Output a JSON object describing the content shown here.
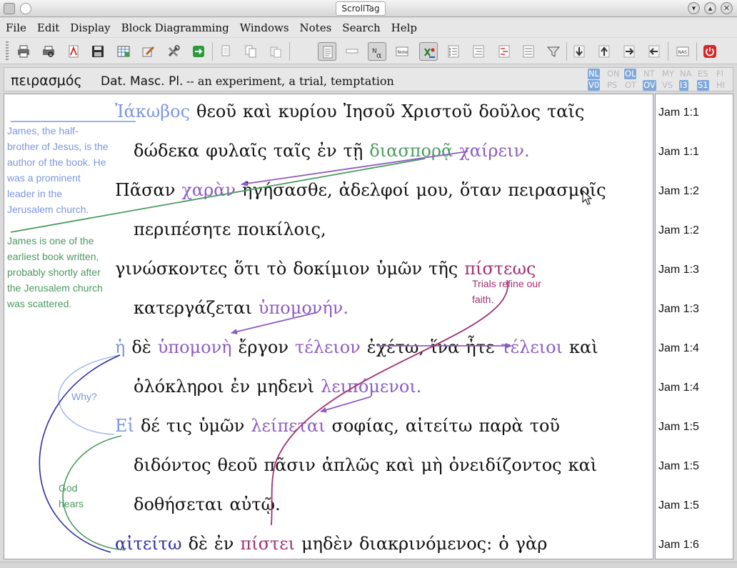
{
  "window": {
    "title": "ScrollTag"
  },
  "menu": [
    "File",
    "Edit",
    "Display",
    "Block Diagramming",
    "Windows",
    "Notes",
    "Search",
    "Help"
  ],
  "toolbar": {
    "tools": [
      "print-icon",
      "print-preview-icon",
      "pdf-icon",
      "save-icon",
      "table-icon",
      "edit-icon",
      "tools-icon",
      "export-icon",
      "copy-icon",
      "copy-alt-icon",
      "paste-icon",
      "page-icon",
      "line-icon",
      "greek-alpha-icon",
      "note-icon",
      "verse-check-icon",
      "numbered-list-icon",
      "align-icon",
      "outline-icon",
      "text-block-icon",
      "filter-icon",
      "down-arrow-icon",
      "up-arrow-icon",
      "next-icon",
      "prev-icon",
      "nas-icon",
      "power-icon"
    ],
    "note_label": "Note",
    "nas_label": "NAS"
  },
  "infobar": {
    "word": "πειρασμός",
    "parse": "Dat. Masc. Pl.",
    "definition": "-- an experiment, a trial, temptation"
  },
  "versions": {
    "row1": [
      {
        "label": "NL",
        "active": true
      },
      {
        "label": "ON",
        "active": false
      },
      {
        "label": "OL",
        "active": true
      },
      {
        "label": "NT",
        "active": false
      },
      {
        "label": "MY",
        "active": false
      },
      {
        "label": "NA",
        "active": false
      },
      {
        "label": "ES",
        "active": false
      },
      {
        "label": "FI",
        "active": false
      }
    ],
    "row2": [
      {
        "label": "V0",
        "active": true
      },
      {
        "label": "PS",
        "active": false
      },
      {
        "label": "OT",
        "active": false
      },
      {
        "label": "OV",
        "active": true
      },
      {
        "label": "VS",
        "active": false
      },
      {
        "label": "I3",
        "active": true
      },
      {
        "label": "S1",
        "active": true
      },
      {
        "label": "HI",
        "active": false
      }
    ]
  },
  "text_lines": [
    {
      "ref": "Jam 1:1",
      "indent": false,
      "words": [
        {
          "t": "Ἰάκωβος",
          "c": "w-lblue"
        },
        {
          "t": "θεοῦ"
        },
        {
          "t": "καὶ"
        },
        {
          "t": "κυρίου"
        },
        {
          "t": "Ἰησοῦ"
        },
        {
          "t": "Χριστοῦ"
        },
        {
          "t": "δοῦλος"
        },
        {
          "t": "ταῖς"
        }
      ]
    },
    {
      "ref": "Jam 1:1",
      "indent": true,
      "words": [
        {
          "t": "δώδεκα"
        },
        {
          "t": "φυλαῖς"
        },
        {
          "t": "ταῖς"
        },
        {
          "t": "ἐν"
        },
        {
          "t": "τῇ"
        },
        {
          "t": "διασπορᾷ",
          "c": "w-green"
        },
        {
          "t": "χαίρειν.",
          "c": "w-purple"
        }
      ]
    },
    {
      "ref": "Jam 1:2",
      "indent": false,
      "words": [
        {
          "t": "Πᾶσαν"
        },
        {
          "t": "χαρὰν",
          "c": "w-purple"
        },
        {
          "t": "ἡγήσασθε,"
        },
        {
          "t": "ἀδελφοί"
        },
        {
          "t": "μου,"
        },
        {
          "t": "ὅταν"
        },
        {
          "t": "πειρασμοῖς"
        }
      ]
    },
    {
      "ref": "Jam 1:2",
      "indent": true,
      "words": [
        {
          "t": "περιπέσητε"
        },
        {
          "t": "ποικίλοις,"
        }
      ]
    },
    {
      "ref": "Jam 1:3",
      "indent": false,
      "words": [
        {
          "t": "γινώσκοντες"
        },
        {
          "t": "ὅτι"
        },
        {
          "t": "τὸ"
        },
        {
          "t": "δοκίμιον"
        },
        {
          "t": "ὑμῶν"
        },
        {
          "t": "τῆς"
        },
        {
          "t": "πίστεως",
          "c": "w-maroon"
        }
      ]
    },
    {
      "ref": "Jam 1:3",
      "indent": true,
      "words": [
        {
          "t": "κατεργάζεται"
        },
        {
          "t": "ὑπομονήν.",
          "c": "w-purple"
        }
      ]
    },
    {
      "ref": "Jam 1:4",
      "indent": false,
      "words": [
        {
          "t": "ἡ",
          "c": "w-lblue"
        },
        {
          "t": "δὲ"
        },
        {
          "t": "ὑπομονὴ",
          "c": "w-purple"
        },
        {
          "t": "ἔργον"
        },
        {
          "t": "τέλειον",
          "c": "w-purple"
        },
        {
          "t": "ἐχέτω,"
        },
        {
          "t": "ἵνα"
        },
        {
          "t": "ἦτε"
        },
        {
          "t": "τέλειοι",
          "c": "w-purple"
        },
        {
          "t": "καὶ"
        }
      ]
    },
    {
      "ref": "Jam 1:4",
      "indent": true,
      "words": [
        {
          "t": "ὁλόκληροι"
        },
        {
          "t": "ἐν"
        },
        {
          "t": "μηδενὶ"
        },
        {
          "t": "λειπόμενοι.",
          "c": "w-purple"
        }
      ]
    },
    {
      "ref": "Jam 1:5",
      "indent": false,
      "words": [
        {
          "t": "Εἰ",
          "c": "w-lblue"
        },
        {
          "t": "δέ"
        },
        {
          "t": "τις"
        },
        {
          "t": "ὑμῶν"
        },
        {
          "t": "λείπεται",
          "c": "w-purple"
        },
        {
          "t": "σοφίας,"
        },
        {
          "t": "αἰτείτω"
        },
        {
          "t": "παρὰ"
        },
        {
          "t": "τοῦ"
        }
      ]
    },
    {
      "ref": "Jam 1:5",
      "indent": true,
      "words": [
        {
          "t": "διδόντος"
        },
        {
          "t": "θεοῦ"
        },
        {
          "t": "πᾶσιν"
        },
        {
          "t": "ἁπλῶς"
        },
        {
          "t": "καὶ"
        },
        {
          "t": "μὴ"
        },
        {
          "t": "ὀνειδίζοντος"
        },
        {
          "t": "καὶ"
        }
      ]
    },
    {
      "ref": "Jam 1:5",
      "indent": true,
      "words": [
        {
          "t": "δοθήσεται"
        },
        {
          "t": "αὐτῷ."
        }
      ]
    },
    {
      "ref": "Jam 1:6",
      "indent": false,
      "words": [
        {
          "t": "αἰτείτω",
          "c": "w-navy"
        },
        {
          "t": "δὲ"
        },
        {
          "t": "ἐν"
        },
        {
          "t": "πίστει",
          "c": "w-maroon"
        },
        {
          "t": "μηδὲν"
        },
        {
          "t": "διακρινόμενος:"
        },
        {
          "t": "ὁ"
        },
        {
          "t": "γὰρ"
        }
      ]
    }
  ],
  "notes": {
    "james_author": "James, the half-brother of Jesus, is the author of the book. He was a prominent leader in the Jerusalem church.",
    "earliest_book": "James is one of the earliest book written, probably shortly after the Jerusalem church was scattered.",
    "trials": "Trials refine our faith.",
    "why": "Why?",
    "god_hears": "God hears"
  },
  "colors": {
    "light_blue": "#7b97de",
    "green": "#4a9a60",
    "purple": "#8d5cc2",
    "maroon": "#a13173",
    "navy": "#2f2fa5",
    "badge_on": "#7fa8dc"
  }
}
